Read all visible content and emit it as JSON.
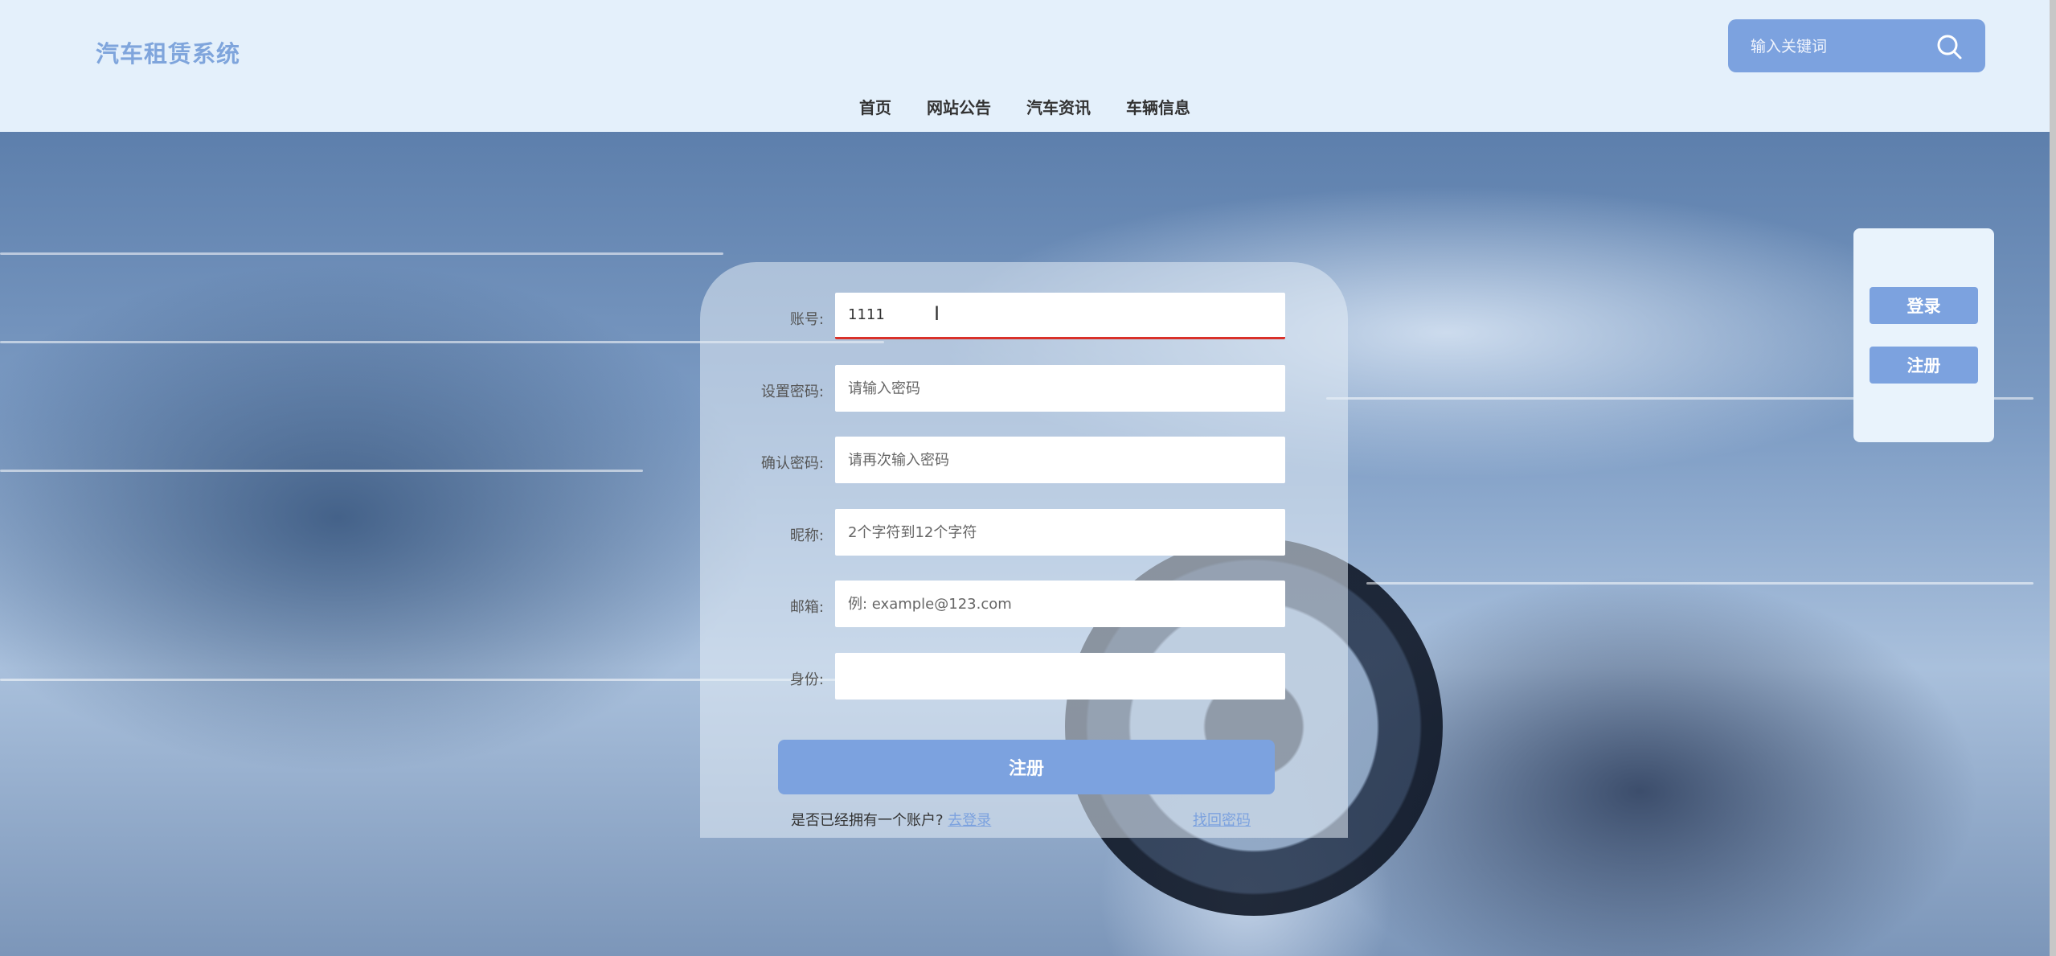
{
  "header": {
    "logo": "汽车租赁系统",
    "search": {
      "placeholder": "输入关键词"
    },
    "nav": [
      "首页",
      "网站公告",
      "汽车资讯",
      "车辆信息"
    ]
  },
  "side": {
    "login": "登录",
    "register": "注册"
  },
  "form": {
    "fields": [
      {
        "label": "账号:",
        "value": "1111",
        "placeholder": ""
      },
      {
        "label": "设置密码:",
        "value": "",
        "placeholder": "请输入密码"
      },
      {
        "label": "确认密码:",
        "value": "",
        "placeholder": "请再次输入密码"
      },
      {
        "label": "昵称:",
        "value": "",
        "placeholder": "2个字符到12个字符"
      },
      {
        "label": "邮箱:",
        "value": "",
        "placeholder": "例: example@123.com"
      },
      {
        "label": "身份:",
        "value": "",
        "placeholder": ""
      }
    ],
    "submit": "注册",
    "has_account": "是否已经拥有一个账户?",
    "go_login": "去登录",
    "forgot": "找回密码"
  },
  "colors": {
    "accent": "#7ca2df",
    "header_bg": "#e4f0fb",
    "active_underline": "#d9312a"
  }
}
